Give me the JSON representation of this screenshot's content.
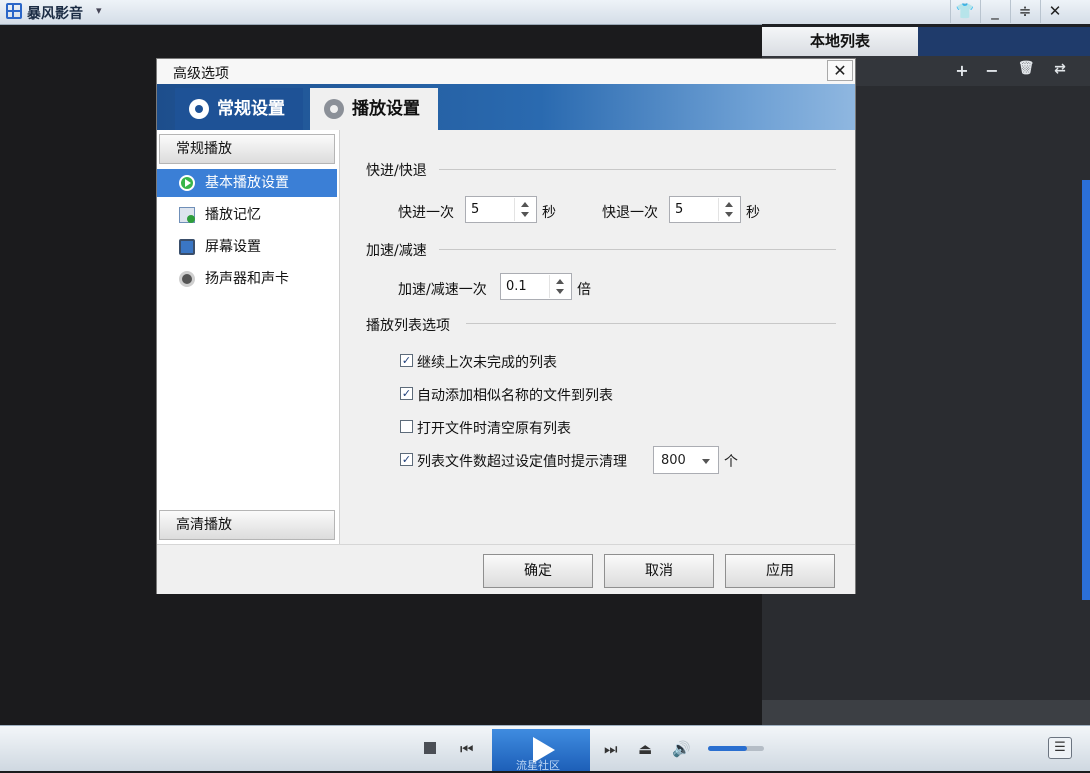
{
  "app": {
    "title": "暴风影音",
    "dropdown_glyph": "▾",
    "window_buttons": [
      "👕",
      "_",
      "≑",
      "✕"
    ]
  },
  "playlist": {
    "tab_label": "本地列表",
    "tools": [
      "+",
      "−",
      "🗑",
      "⇄"
    ]
  },
  "controls": {
    "prev_glyph": "⏮",
    "next_glyph": "⏭",
    "eject_glyph": "⏏",
    "volume_glyph": "🔊",
    "menu_glyph": "☰",
    "volume_level": 0.7,
    "watermark": "流星社区"
  },
  "dialog": {
    "title": "高级选项",
    "close_glyph": "✕",
    "tabs": [
      "常规设置",
      "播放设置"
    ],
    "nav": {
      "group_regular": "常规播放",
      "items": [
        "基本播放设置",
        "播放记忆",
        "屏幕设置",
        "扬声器和声卡"
      ],
      "group_hd": "高清播放"
    },
    "sections": {
      "seek": "快进/快退",
      "speed": "加速/减速",
      "playlist": "播放列表选项"
    },
    "seek": {
      "forward_label": "快进一次",
      "forward_value": "5",
      "forward_unit": "秒",
      "backward_label": "快退一次",
      "backward_value": "5",
      "backward_unit": "秒"
    },
    "speed": {
      "label": "加速/减速一次",
      "value": "0.1",
      "unit": "倍"
    },
    "options": [
      {
        "label": "继续上次未完成的列表",
        "checked": true
      },
      {
        "label": "自动添加相似名称的文件到列表",
        "checked": true
      },
      {
        "label": "打开文件时清空原有列表",
        "checked": false
      },
      {
        "label": "列表文件数超过设定值时提示清理",
        "checked": true
      }
    ],
    "file_count": {
      "value": "800",
      "unit": "个"
    },
    "buttons": {
      "ok": "确定",
      "cancel": "取消",
      "apply": "应用"
    }
  }
}
